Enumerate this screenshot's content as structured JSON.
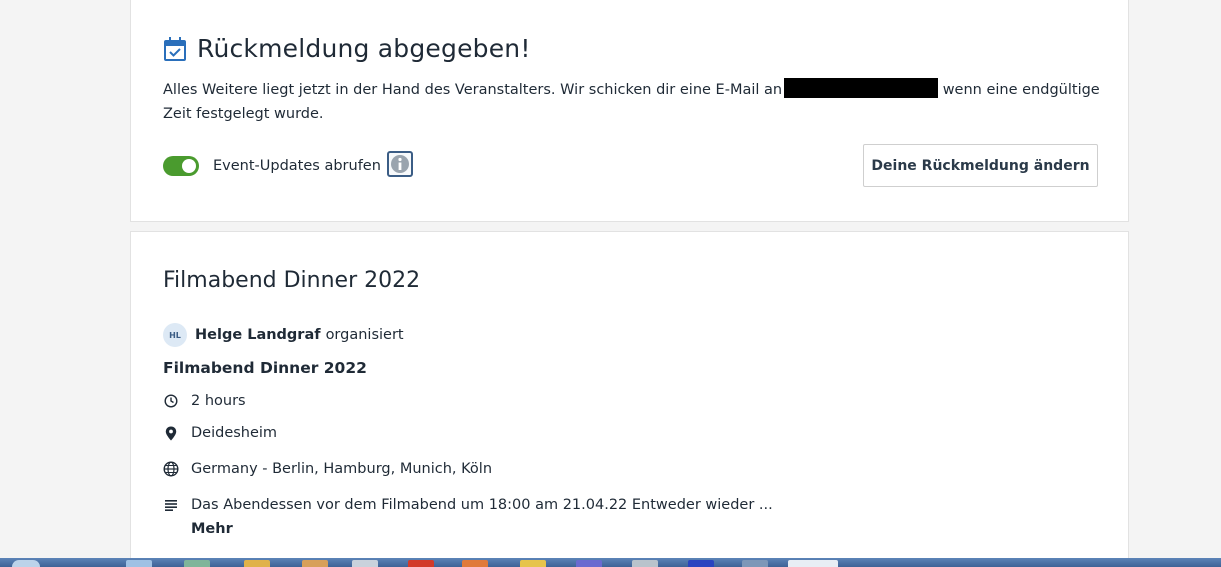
{
  "confirmation": {
    "icon": "calendar-check-icon",
    "title": "Rückmeldung abgegeben!",
    "text_before": "Alles Weitere liegt jetzt in der Hand des Veranstalters. Wir schicken dir eine E-Mail an",
    "text_after": "wenn eine endgültige Zeit festgelegt wurde.",
    "toggle_label": "Event-Updates abrufen",
    "toggle_on": true,
    "change_button": "Deine Rückmeldung ändern"
  },
  "event": {
    "title": "Filmabend Dinner 2022",
    "organizer_initials": "HL",
    "organizer_name": "Helge Landgraf",
    "organizer_suffix": "organisiert",
    "subtitle": "Filmabend Dinner 2022",
    "duration": "2 hours",
    "location": "Deidesheim",
    "timezone": "Germany - Berlin, Hamburg, Munich, Köln",
    "description": "Das Abendessen vor dem Filmabend um 18:00 am 21.04.22 Entweder wieder ...",
    "more_link": "Mehr"
  },
  "colors": {
    "accent": "#2a6fbb",
    "toggle": "#4a9b2e",
    "text": "#1f2a36",
    "taskbar": "#4a6fa5"
  }
}
